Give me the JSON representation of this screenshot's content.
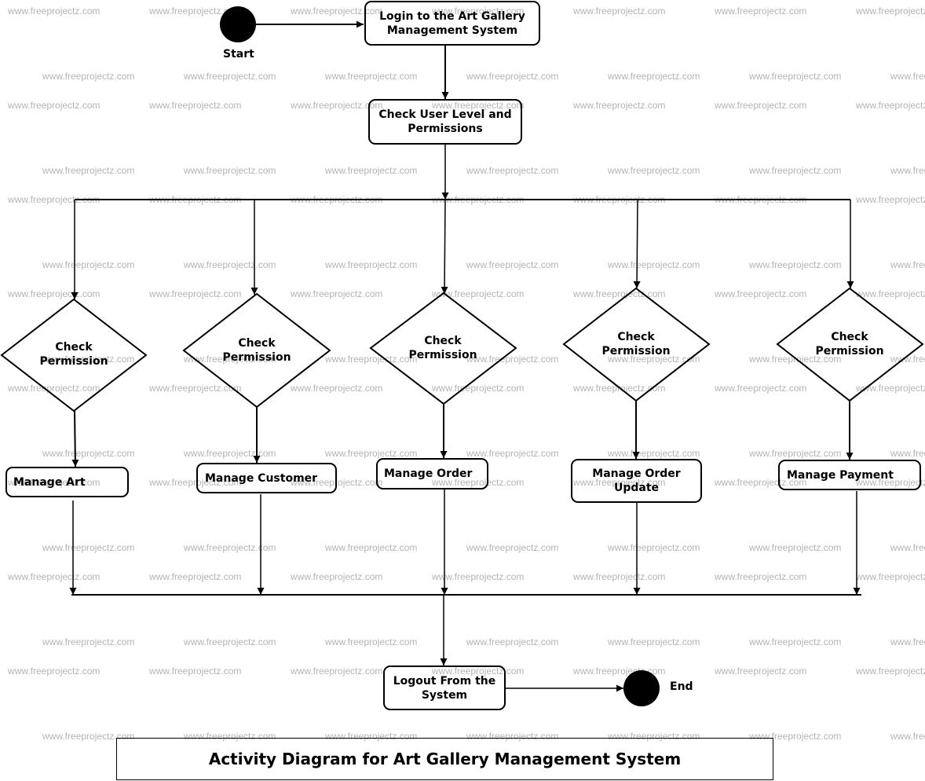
{
  "diagram": {
    "title": "Activity Diagram for Art Gallery Management System",
    "watermark": "www.freeprojectz.com",
    "start_label": "Start",
    "end_label": "End",
    "login": "Login to the Art Gallery Management System",
    "check_user": "Check User Level and Permissions",
    "logout": "Logout From the System",
    "branches": [
      {
        "decision": "Check Permission",
        "activity": "Manage Art"
      },
      {
        "decision": "Check Permission",
        "activity": "Manage Customer"
      },
      {
        "decision": "Check Permission",
        "activity": "Manage Order"
      },
      {
        "decision": "Check Permission",
        "activity": "Manage Order Update"
      },
      {
        "decision": "Check Permission",
        "activity": "Manage Payment"
      }
    ],
    "colors": {
      "stroke": "#000000",
      "background": "#ffffff",
      "watermark": "#b4b4b4"
    }
  }
}
